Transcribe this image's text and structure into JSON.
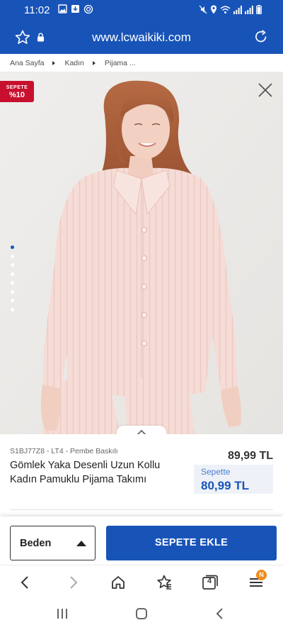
{
  "status_bar": {
    "time": "11:02",
    "left_icons": [
      "image-icon",
      "download-icon",
      "sync-icon"
    ],
    "right_icons": [
      "mute-icon",
      "location-icon",
      "wifi-icon",
      "signal-icon",
      "signal-icon",
      "battery-icon"
    ]
  },
  "browser": {
    "url": "www.lcwaikiki.com",
    "left_icons": [
      "star-icon",
      "lock-icon"
    ],
    "right_icon": "reload-icon",
    "tab_count": "4",
    "menu_badge": "N"
  },
  "breadcrumb": {
    "items": [
      "Ana Sayfa",
      "Kadın",
      "Pijama ..."
    ]
  },
  "product": {
    "badge_line1": "SEPETE",
    "badge_line2": "%10",
    "sku": "S1BJ77Z8 - LT4 - Pembe Baskılı",
    "name": "Gömlek Yaka Desenli Uzun Kollu Kadın Pamuklu Pijama Takımı",
    "price": "89,99 TL",
    "basket_label": "Sepette",
    "basket_price": "80,99 TL",
    "gallery_dots": 8,
    "active_dot": 0
  },
  "actions": {
    "size_label": "Beden",
    "add_to_cart": "SEPETE EKLE"
  },
  "colors": {
    "brand_blue": "#1854b8",
    "badge_red": "#c8102e",
    "menu_badge_orange": "#f28b1c",
    "basket_bg": "#eef2f8",
    "pajama_pink": "#f4d6d0"
  }
}
